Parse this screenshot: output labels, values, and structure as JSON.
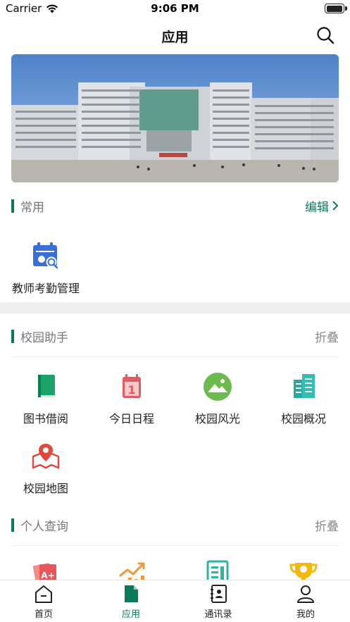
{
  "status_bar": {
    "carrier": "Carrier",
    "time": "9:06 PM"
  },
  "nav": {
    "title": "应用"
  },
  "sections": {
    "common": {
      "title": "常用",
      "action": "编辑",
      "items": [
        {
          "label": "教师考勤管理",
          "icon": "attendance-calendar-icon"
        }
      ]
    },
    "campus_assistant": {
      "title": "校园助手",
      "action": "折叠",
      "items": [
        {
          "label": "图书借阅",
          "icon": "book-icon"
        },
        {
          "label": "今日日程",
          "icon": "calendar-icon"
        },
        {
          "label": "校园风光",
          "icon": "landscape-icon"
        },
        {
          "label": "校园概况",
          "icon": "building-icon"
        },
        {
          "label": "校园地图",
          "icon": "map-pin-icon"
        }
      ]
    },
    "personal_query": {
      "title": "个人查询",
      "action": "折叠",
      "items": [
        {
          "label": "",
          "icon": "grades-icon"
        },
        {
          "label": "",
          "icon": "chart-icon"
        },
        {
          "label": "",
          "icon": "document-icon"
        },
        {
          "label": "",
          "icon": "trophy-icon"
        }
      ]
    }
  },
  "tab_bar": {
    "tabs": [
      {
        "label": "首页",
        "icon": "home-icon"
      },
      {
        "label": "应用",
        "icon": "apps-icon",
        "active": true
      },
      {
        "label": "通讯录",
        "icon": "contacts-icon"
      },
      {
        "label": "我的",
        "icon": "profile-icon"
      }
    ]
  },
  "colors": {
    "accent": "#0a7a5a",
    "section_bar": "#0a7a5a",
    "band": "#efefef"
  }
}
